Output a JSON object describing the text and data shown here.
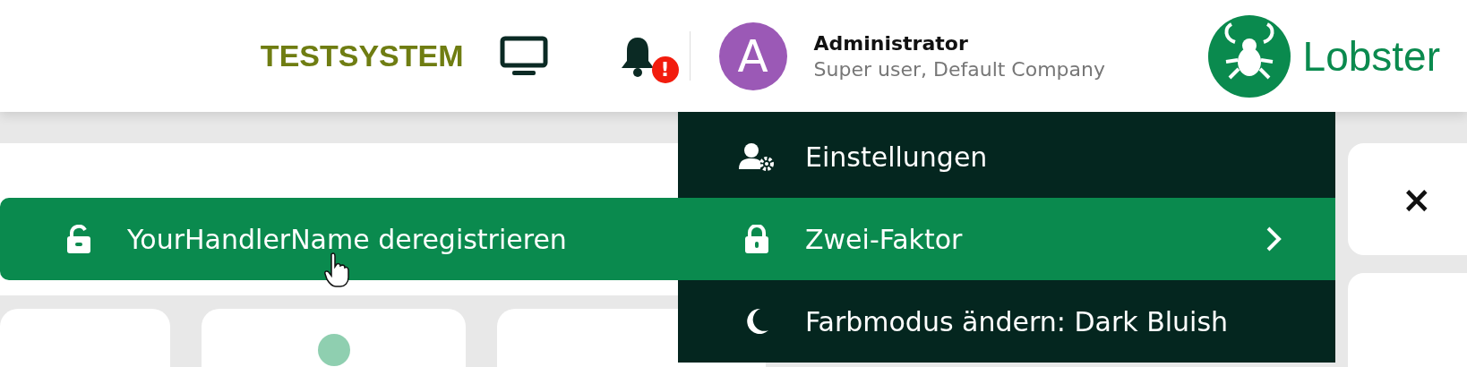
{
  "header": {
    "system_label": "TESTSYSTEM",
    "notification_alert": "!",
    "user": {
      "avatar_letter": "A",
      "name": "Administrator",
      "role": "Super user, Default Company"
    },
    "logo_text": "Lobster"
  },
  "user_menu": {
    "items": [
      {
        "kind": "settings",
        "label": "Einstellungen",
        "selected": false,
        "has_submenu": false
      },
      {
        "kind": "lock",
        "label": "Zwei-Faktor",
        "selected": true,
        "has_submenu": true
      },
      {
        "kind": "moon",
        "label": "Farbmodus ändern: Dark Bluish",
        "selected": false,
        "has_submenu": false
      }
    ]
  },
  "submenu": {
    "items": [
      {
        "kind": "unlock",
        "label": "YourHandlerName deregistrieren"
      }
    ]
  },
  "dialog": {
    "close": "×"
  }
}
